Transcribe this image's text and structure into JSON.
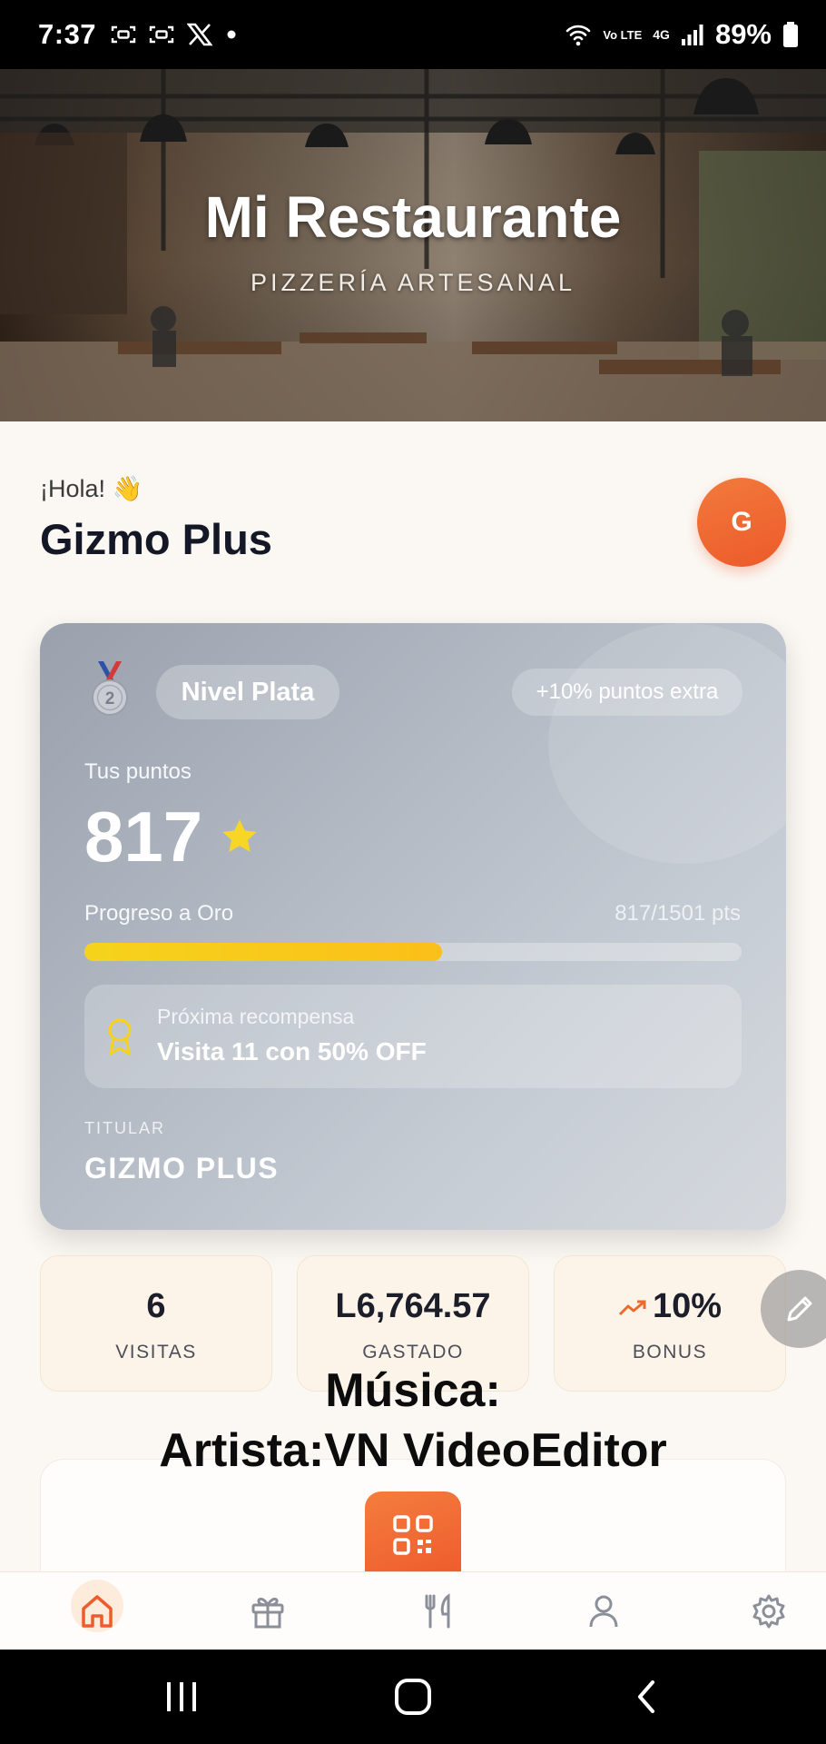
{
  "status_bar": {
    "time": "7:37",
    "left_icons": [
      "screenshot-icon",
      "screenshot-icon",
      "x-logo-icon",
      "dot-icon"
    ],
    "lte_label": "Vo LTE",
    "network_label": "4G",
    "battery": "89%"
  },
  "hero": {
    "title": "Mi Restaurante",
    "subtitle": "PIZZERÍA ARTESANAL"
  },
  "greeting": {
    "hello": "¡Hola! 👋",
    "name": "Gizmo Plus",
    "avatar_initial": "G"
  },
  "loyalty_card": {
    "medal_number": "2",
    "level": "Nivel Plata",
    "bonus_badge": "+10% puntos extra",
    "points_label": "Tus puntos",
    "points": "817",
    "progress_label": "Progreso a Oro",
    "progress_count": "817/1501 pts",
    "progress_fraction": 0.544,
    "reward_label": "Próxima recompensa",
    "reward_value": "Visita 11 con 50% OFF",
    "holder_label": "TITULAR",
    "holder_name": "GIZMO PLUS"
  },
  "stats": [
    {
      "value": "6",
      "label": "VISITAS"
    },
    {
      "value": "L6,764.57",
      "label": "GASTADO"
    },
    {
      "value": "10%",
      "label": "BONUS",
      "icon": "trend-up-icon"
    }
  ],
  "caption": {
    "line1": "Música:",
    "line2": "Artista:VN VideoEditor"
  },
  "bottom_nav": [
    {
      "icon": "home-icon",
      "active": true
    },
    {
      "icon": "gift-icon",
      "active": false
    },
    {
      "icon": "utensils-icon",
      "active": false
    },
    {
      "icon": "user-icon",
      "active": false
    },
    {
      "icon": "gear-icon",
      "active": false
    }
  ],
  "colors": {
    "accent": "#ee5b2c",
    "progress": "#f5d31c",
    "card": "#b3bac4"
  }
}
